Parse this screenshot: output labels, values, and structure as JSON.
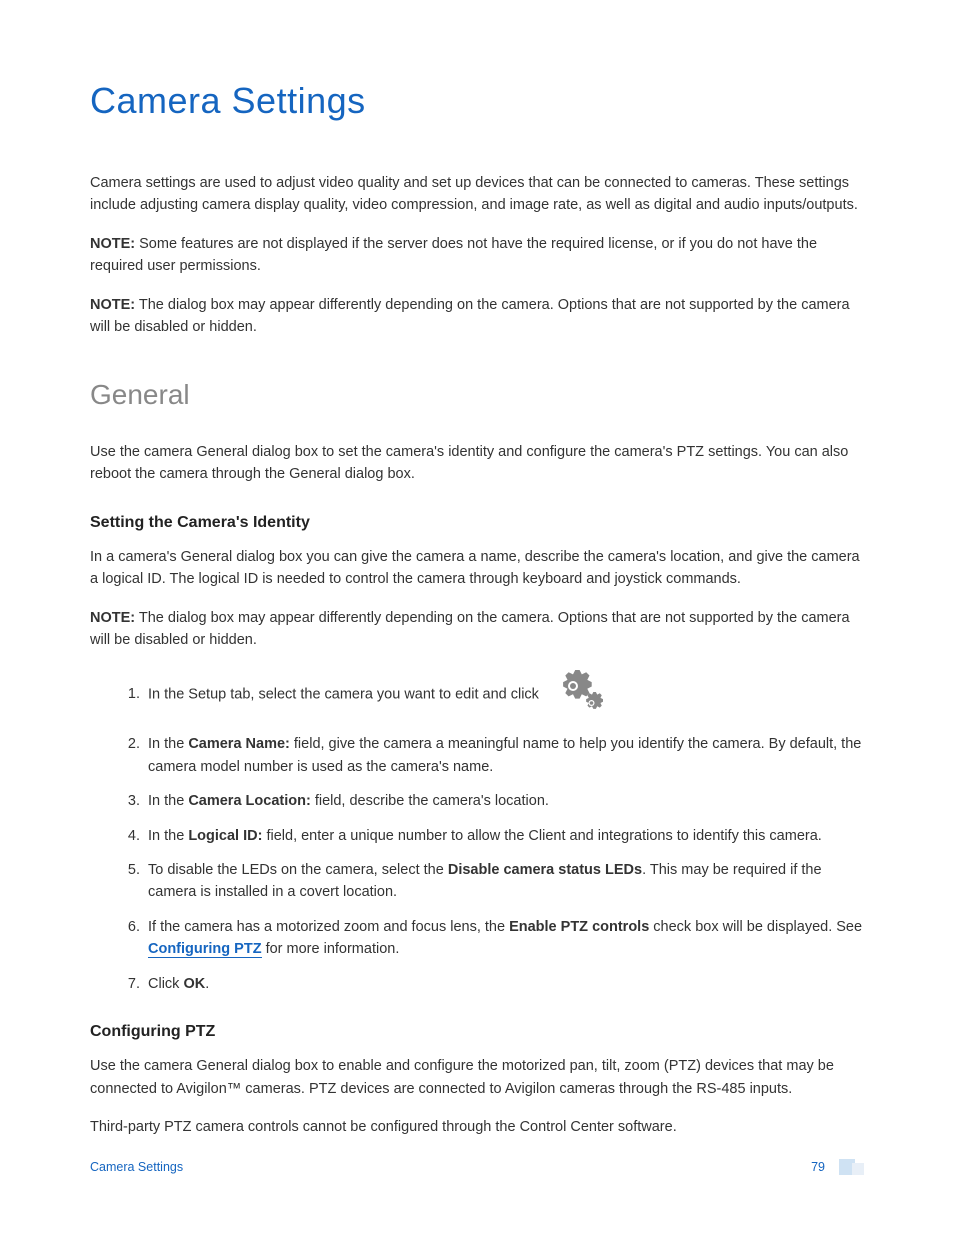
{
  "title": "Camera Settings",
  "intro": "Camera settings are used to adjust video quality and set up devices that can be connected to cameras. These settings include adjusting camera display quality, video compression, and image rate, as well as digital and audio inputs/outputs.",
  "noteLabel": "NOTE:",
  "note1": " Some features are not displayed if the server does not have the required license, or if you do not have the required user permissions.",
  "note2": " The dialog box may appear differently depending on the camera. Options that are not supported by the camera will be disabled or hidden.",
  "general": {
    "heading": "General",
    "intro": "Use the camera General dialog box to set the camera's identity and configure the camera's PTZ settings. You can also reboot the camera through the General dialog box.",
    "identity": {
      "heading": "Setting the Camera's Identity",
      "p1": "In a camera's General dialog box you can give the camera a name, describe the camera's location, and give the camera a logical ID. The logical ID is needed to control the camera through keyboard and joystick commands.",
      "note": " The dialog box may appear differently depending on the camera. Options that are not supported by the camera will be disabled or hidden.",
      "steps": {
        "s1_a": "In the Setup tab, select the camera you want to edit and click",
        "s2_a": "In the ",
        "s2_b": "Camera Name:",
        "s2_c": " field, give the camera a meaningful name to help you identify the camera. By default, the camera model number is used as the camera's name.",
        "s3_a": "In the ",
        "s3_b": "Camera Location:",
        "s3_c": " field, describe the camera's location.",
        "s4_a": "In the ",
        "s4_b": "Logical ID:",
        "s4_c": " field, enter a unique number to allow the Client and integrations to identify this camera.",
        "s5_a": "To disable the LEDs on the camera, select the ",
        "s5_b": "Disable camera status LEDs",
        "s5_c": ". This may be required if the camera is installed in a covert location.",
        "s6_a": "If the camera has a motorized zoom and focus lens, the ",
        "s6_b": "Enable PTZ controls",
        "s6_c": " check box will be displayed. See ",
        "s6_link": "Configuring PTZ",
        "s6_d": " for more information.",
        "s7_a": "Click ",
        "s7_b": "OK",
        "s7_c": "."
      }
    },
    "ptz": {
      "heading": "Configuring PTZ",
      "p1": "Use the camera General dialog box to enable and configure the motorized pan, tilt, zoom (PTZ) devices that may be connected to Avigilon™ cameras.  PTZ devices are connected to Avigilon cameras through the RS-485 inputs.",
      "p2": "Third-party PTZ camera controls cannot be configured through the Control Center software."
    }
  },
  "footer": {
    "left": "Camera Settings",
    "right": "79"
  }
}
